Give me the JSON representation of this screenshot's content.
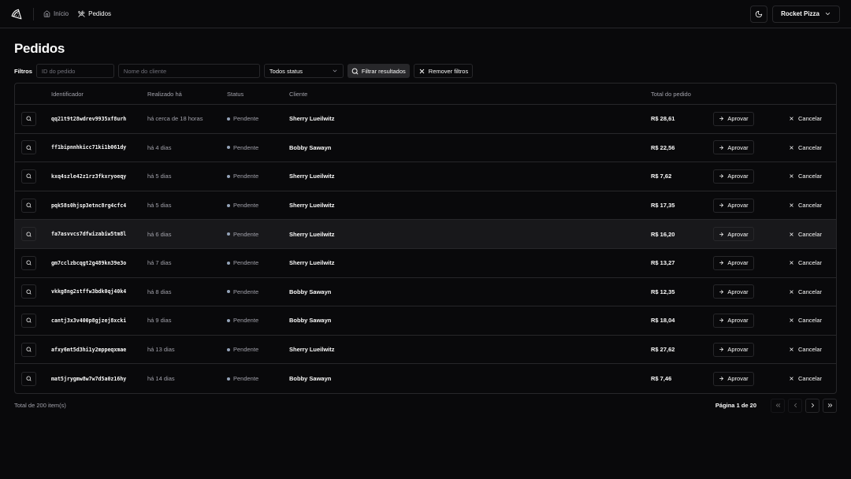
{
  "header": {
    "nav": [
      {
        "label": "Início",
        "icon": "home-icon"
      },
      {
        "label": "Pedidos",
        "icon": "utensils-icon"
      }
    ],
    "store_name": "Rocket Pizza"
  },
  "page_title": "Pedidos",
  "filters": {
    "label": "Filtros",
    "order_id_placeholder": "ID do pedido",
    "customer_placeholder": "Nome do cliente",
    "status_selected": "Todos status",
    "apply_label": "Filtrar resultados",
    "remove_label": "Remover filtros"
  },
  "table": {
    "columns": [
      "Identificador",
      "Realizado há",
      "Status",
      "Cliente",
      "Total do pedido"
    ],
    "approve_label": "Aprovar",
    "cancel_label": "Cancelar",
    "rows": [
      {
        "id": "qq21t9t28wdrev9935xf8urh",
        "date": "há cerca de 18 horas",
        "status": "Pendente",
        "client": "Sherry Lueilwitz",
        "total": "R$ 28,61"
      },
      {
        "id": "ff1bipnnhkicc71ki1b061dy",
        "date": "há 4 dias",
        "status": "Pendente",
        "client": "Bobby Sawayn",
        "total": "R$ 22,56"
      },
      {
        "id": "kxq4szle42z1rz3fkxryoeqy",
        "date": "há 5 dias",
        "status": "Pendente",
        "client": "Sherry Lueilwitz",
        "total": "R$ 7,62"
      },
      {
        "id": "pqk58s0hjsp3etnc8rg4cfc4",
        "date": "há 5 dias",
        "status": "Pendente",
        "client": "Sherry Lueilwitz",
        "total": "R$ 17,35"
      },
      {
        "id": "fa7asvvcs7dfwizabiw5tm8l",
        "date": "há 6 dias",
        "status": "Pendente",
        "client": "Sherry Lueilwitz",
        "total": "R$ 16,20"
      },
      {
        "id": "gm7cclzbcqgt2g489kn39e3o",
        "date": "há 7 dias",
        "status": "Pendente",
        "client": "Sherry Lueilwitz",
        "total": "R$ 13,27"
      },
      {
        "id": "vkkg8ng2stffw3bdk0qj40k4",
        "date": "há 8 dias",
        "status": "Pendente",
        "client": "Bobby Sawayn",
        "total": "R$ 12,35"
      },
      {
        "id": "cantj3x3v400p8gjzej8xcki",
        "date": "há 9 dias",
        "status": "Pendente",
        "client": "Bobby Sawayn",
        "total": "R$ 18,04"
      },
      {
        "id": "afxy6mt5d3hi1y2mppeqxmae",
        "date": "há 13 dias",
        "status": "Pendente",
        "client": "Sherry Lueilwitz",
        "total": "R$ 27,62"
      },
      {
        "id": "mat5jrygmw8w7w7d5a0z16hy",
        "date": "há 14 dias",
        "status": "Pendente",
        "client": "Bobby Sawayn",
        "total": "R$ 7,46"
      }
    ]
  },
  "footer": {
    "total_items": "Total de 200 item(s)",
    "page_info": "Página 1 de 20"
  },
  "colors": {
    "background": "#09090b",
    "border": "#27272a",
    "status_pending": "#94a3b8"
  }
}
